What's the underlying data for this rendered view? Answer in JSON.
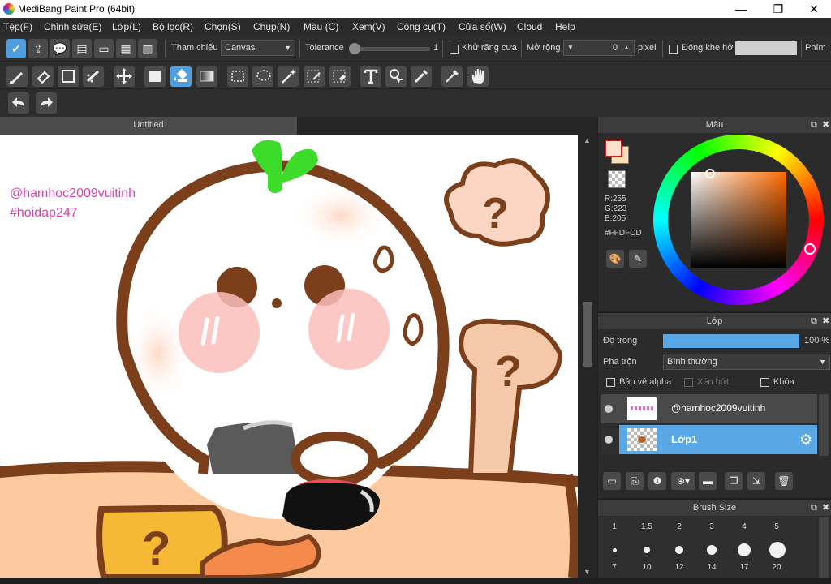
{
  "window": {
    "title": "MediBang Paint Pro (64bit)",
    "minimize_glyph": "—",
    "maximize_glyph": "❐",
    "close_glyph": "✕"
  },
  "menu": [
    "Tệp(F)",
    "Chỉnh sửa(E)",
    "Lớp(L)",
    "Bộ lọc(R)",
    "Chọn(S)",
    "Chụp(N)",
    "Màu (C)",
    "Xem(V)",
    "Công cụ(T)",
    "Cửa sổ(W)",
    "Cloud",
    "Help"
  ],
  "toolbar_top": {
    "ref_label": "Tham chiếu",
    "ref_value": "Canvas",
    "tolerance_label": "Tolerance",
    "tolerance_value": "1",
    "antialias_label": "Khử răng cưa",
    "expand_label": "Mở rộng",
    "expand_value": "0",
    "expand_unit": "pixel",
    "close_gap_label": "Đóng khe hở",
    "fim_label": "Phím"
  },
  "tools": [
    "brush-icon",
    "eraser-icon",
    "rectangle-icon",
    "dotted-brush-icon",
    "move-icon",
    "fill-square-icon",
    "bucket-icon",
    "gradient-icon",
    "select-rect-icon",
    "lasso-icon",
    "magic-wand-icon",
    "select-pen-icon",
    "select-eraser-icon",
    "text-icon",
    "operation-icon",
    "eyedropper-icon",
    "dropper-icon",
    "hand-icon"
  ],
  "document": {
    "tab_title": "Untitled",
    "watermark_line1": "@hamhoc2009vuitinh",
    "watermark_line2": "#hoidap247"
  },
  "color_panel": {
    "title": "Màu",
    "r": "R:255",
    "g": "G:223",
    "b": "B:205",
    "hex": "#FFDFCD",
    "fg_color": "#FFDFCD",
    "ring_marker_color": "#ff7a00"
  },
  "layer_panel": {
    "title": "Lớp",
    "opacity_label": "Độ trong",
    "opacity_value": "100 %",
    "opacity_fraction": 1.0,
    "blend_label": "Pha trộn",
    "blend_value": "Bình thường",
    "protect_alpha": "Bảo vệ alpha",
    "clipping": "Xén bớt",
    "lock": "Khóa",
    "layers": [
      {
        "name": "@hamhoc2009vuitinh",
        "selected": false
      },
      {
        "name": "Lớp1",
        "selected": true
      }
    ]
  },
  "brush_size_panel": {
    "title": "Brush Size",
    "sizes_row1": [
      "1",
      "1.5",
      "2",
      "3",
      "4",
      "5"
    ],
    "sizes_row2": [
      "7",
      "10",
      "12",
      "14",
      "17",
      "20"
    ]
  }
}
